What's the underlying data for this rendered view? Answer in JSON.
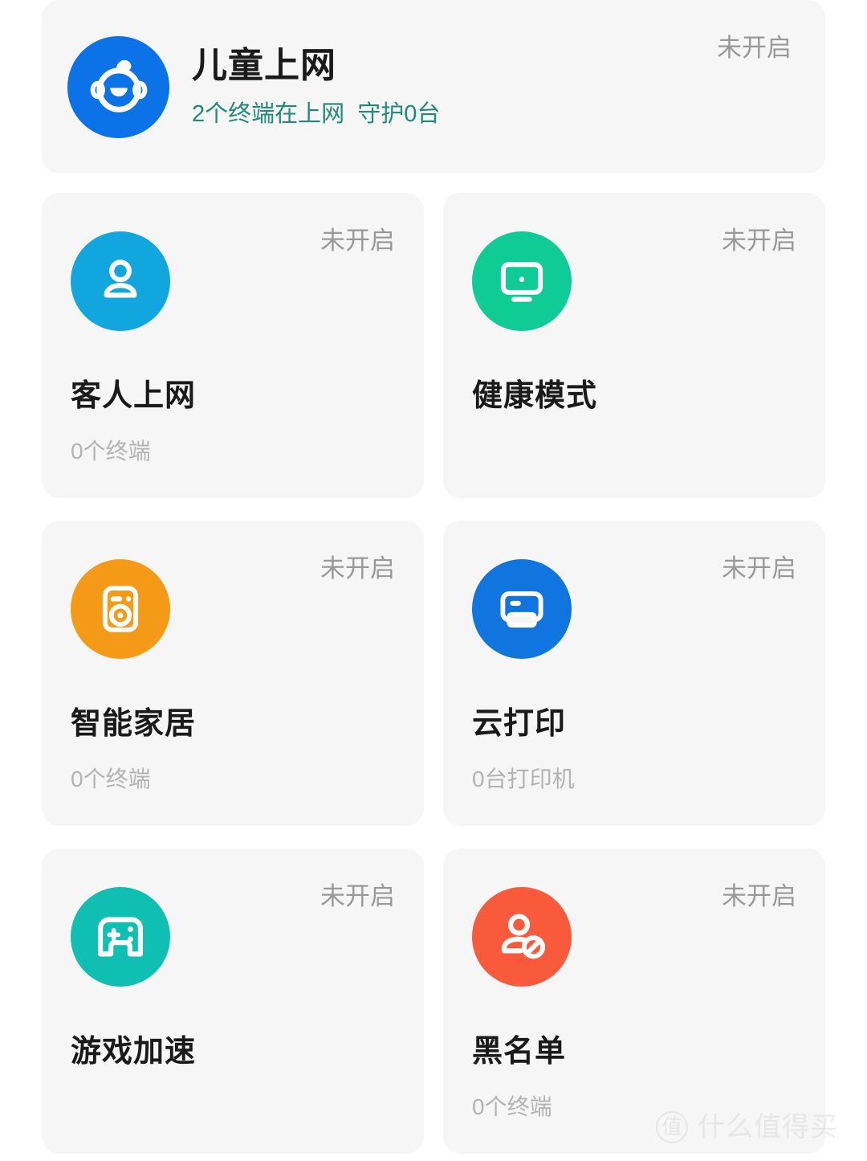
{
  "colors": {
    "page_bg": "#ffffff",
    "card_bg": "#f6f6f6",
    "title": "#1a1a1a",
    "status_gray": "#999999",
    "sub_gray": "#b3b3b3",
    "feature_sub_teal": "#1f8a76",
    "icon_child_blue": "#0B72E7",
    "icon_guest_blue": "#12A6DE",
    "icon_health_green": "#0FCC97",
    "icon_smarthome_orange": "#F59A16",
    "icon_print_blue": "#1175E0",
    "icon_game_teal": "#0FBFB2",
    "icon_blacklist_red": "#FA5A3C"
  },
  "feature": {
    "icon": "child-face-icon",
    "title": "儿童上网",
    "subtitle": "2个终端在上网  守护0台",
    "status": "未开启"
  },
  "tiles": [
    {
      "icon": "person-icon",
      "title": "客人上网",
      "subtitle": "0个终端",
      "status": "未开启"
    },
    {
      "icon": "monitor-icon",
      "title": "健康模式",
      "subtitle": "",
      "status": "未开启"
    },
    {
      "icon": "washing-machine-icon",
      "title": "智能家居",
      "subtitle": "0个终端",
      "status": "未开启"
    },
    {
      "icon": "printer-icon",
      "title": "云打印",
      "subtitle": "0台打印机",
      "status": "未开启"
    },
    {
      "icon": "gamepad-icon",
      "title": "游戏加速",
      "subtitle": "",
      "status": "未开启"
    },
    {
      "icon": "person-blocked-icon",
      "title": "黑名单",
      "subtitle": "0个终端",
      "status": "未开启"
    }
  ],
  "watermark": {
    "badge": "值",
    "text": "什么值得买"
  }
}
